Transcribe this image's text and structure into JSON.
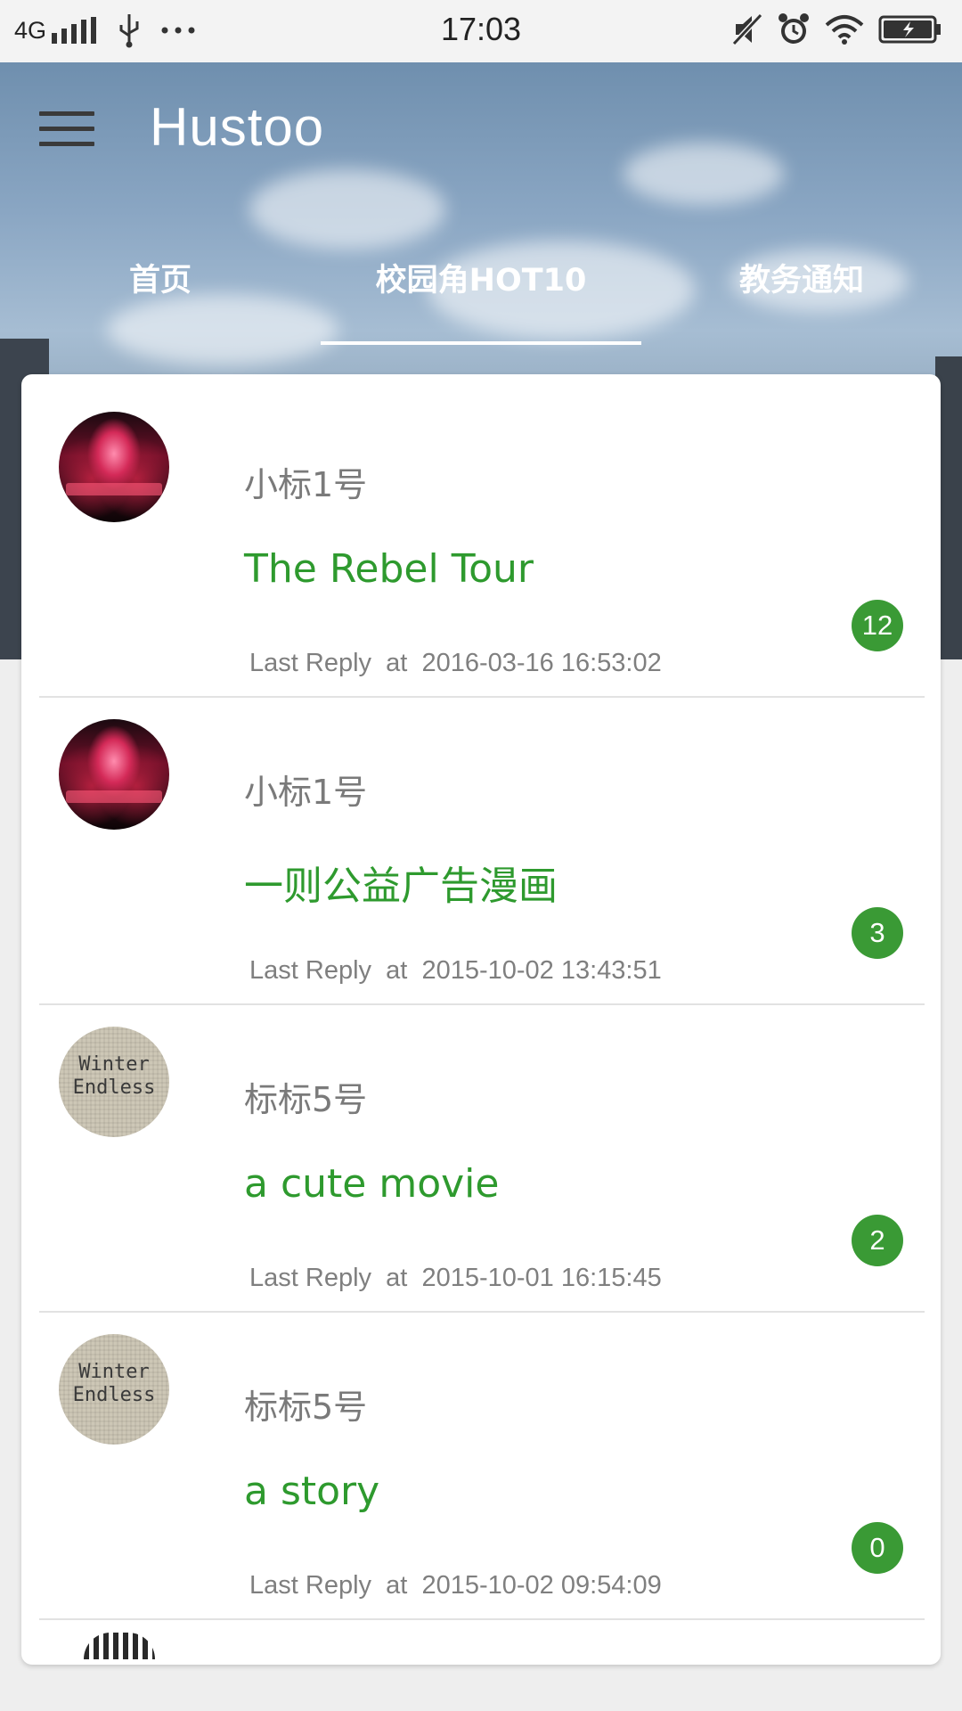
{
  "status_bar": {
    "network": "4G",
    "time": "17:03",
    "icons": [
      "signal-icon",
      "usb-icon",
      "more-dots-icon",
      "mute-icon",
      "alarm-icon",
      "wifi-icon",
      "battery-charging-icon"
    ]
  },
  "app": {
    "title": "Hustoo"
  },
  "tabs": [
    {
      "label": "首页",
      "active": false
    },
    {
      "label": "校园角HOT10",
      "active": true
    },
    {
      "label": "教务通知",
      "active": false
    }
  ],
  "colors": {
    "accent_green": "#2e9a2e",
    "badge_green": "#3a9a35",
    "meta_gray": "#7f7f7f"
  },
  "posts": [
    {
      "author": "小标1号",
      "title": "The Rebel Tour",
      "last_reply_label": "Last Reply",
      "at_label": "at",
      "last_reply_time": "2016-03-16 16:53:02",
      "reply_count": "12",
      "avatar": "stage-photo"
    },
    {
      "author": "小标1号",
      "title": "一则公益广告漫画",
      "last_reply_label": "Last Reply",
      "at_label": "at",
      "last_reply_time": "2015-10-02 13:43:51",
      "reply_count": "3",
      "avatar": "stage-photo"
    },
    {
      "author": "标标5号",
      "title": "a cute movie",
      "last_reply_label": "Last Reply",
      "at_label": "at",
      "last_reply_time": "2015-10-01 16:15:45",
      "reply_count": "2",
      "avatar": "winter-endless-fabric",
      "avatar_text": [
        "Winter",
        "Endless"
      ]
    },
    {
      "author": "标标5号",
      "title": "a story",
      "last_reply_label": "Last Reply",
      "at_label": "at",
      "last_reply_time": "2015-10-02 09:54:09",
      "reply_count": "0",
      "avatar": "winter-endless-fabric",
      "avatar_text": [
        "Winter",
        "Endless"
      ]
    }
  ]
}
